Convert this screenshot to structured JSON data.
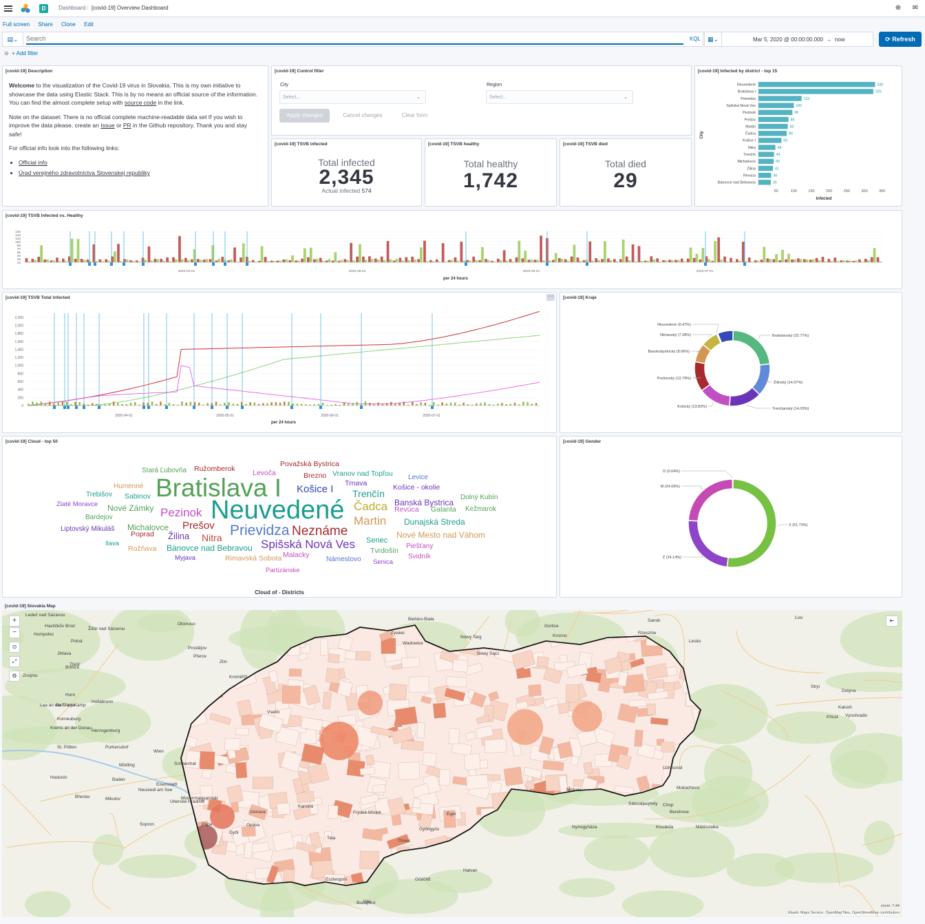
{
  "header": {
    "breadcrumb_root": "Dashboard",
    "breadcrumb_current": "[covid-19] Overview Dashboard",
    "space_letter": "D"
  },
  "links": [
    "Full screen",
    "Share",
    "Clone",
    "Edit"
  ],
  "query": {
    "placeholder": "Search",
    "language": "KQL",
    "date_from": "Mar 5, 2020 @ 00:00:00.000",
    "arrow": "→",
    "date_to": "now",
    "refresh_label": "Refresh",
    "add_filter": "+ Add filter"
  },
  "panels": {
    "description": {
      "title": "[covid-19] Description",
      "p1_bold": "Welcome",
      "p1_rest": " to the visualization of the Covid-19 virus in Slovakia. This is my own initiative to showcase the data using Elastic Stack. This is by no means an official source of the information. You can find the almost complete setup with ",
      "p1_link": "source code",
      "p1_end": " in the link.",
      "p2_a": "Note on the dataset: There is no official complete machine-readable data set If you wish to improve the data please, create an ",
      "p2_issue": "Issue",
      "p2_or": " or ",
      "p2_pr": "PR",
      "p2_end": " in the Github repository. Thank you and stay safe!",
      "p3": "For official info look into the following links:",
      "link1": "Official info",
      "link2": "Úrad verejného zdravotníctva Slovenskej republiky"
    },
    "control": {
      "title": "[covid-19] Control filter",
      "city_label": "City",
      "region_label": "Region",
      "select_placeholder": "Select...",
      "apply": "Apply changes",
      "cancel": "Cancel changes",
      "clear": "Clear form"
    },
    "infected": {
      "title": "[covid-19] TSVB infected",
      "label": "Total infected",
      "value": "2,345",
      "sub_label": "Actual infected",
      "sub_value": "574"
    },
    "healthy": {
      "title": "[covid-19] TSVB healthy",
      "label": "Total healthy",
      "value": "1,742"
    },
    "died": {
      "title": "[covid-19] TSVB died",
      "label": "Total died",
      "value": "29"
    },
    "district": {
      "title": "[covid-19] Infected by district - top 15",
      "ylabel": "City",
      "xlabel": "Infected"
    },
    "inf_vs_healthy": {
      "title": "[covid-19] TSVB Infected vs. Healthy",
      "xlabel": "per 24 hours"
    },
    "total_infected": {
      "title": "[covid-19] TSVB Total infected",
      "xlabel": "per 24 hours"
    },
    "kraje": {
      "title": "[covid-19] Kraje"
    },
    "cloud": {
      "title": "[covid-19] Cloud - top 50",
      "caption": "Cloud of - Districts"
    },
    "gender": {
      "title": "[covid-19] Gender"
    },
    "map": {
      "title": "[covid-19] Slovakia Map",
      "attribution": "Elastic Maps Service, OpenMapTiles, OpenStreetMap contributors",
      "zoom": "zoom: 7.44"
    }
  },
  "chart_data": [
    {
      "type": "bar",
      "id": "district",
      "categories": [
        "Neuvedené",
        "Bratislava I",
        "Prievidza",
        "Spišská Nová Ves",
        "Pezinok",
        "Prešov",
        "Martin",
        "Čadca",
        "Košice I",
        "Nitra",
        "Trenčín",
        "Michalovce",
        "Žilina",
        "Revúca",
        "Bánovce nad Bebravou"
      ],
      "values": [
        330,
        325,
        122,
        100,
        96,
        85,
        83,
        80,
        65,
        48,
        44,
        43,
        41,
        36,
        35
      ],
      "xticks": [
        50,
        100,
        150,
        200,
        250,
        300,
        350
      ],
      "xlim": [
        0,
        370
      ],
      "xlabel": "Infected",
      "ylabel": "City",
      "color": "#54b3c2"
    },
    {
      "type": "bar",
      "id": "inf_vs_healthy",
      "yticks": [
        10,
        25,
        40,
        55,
        70,
        85,
        100,
        110,
        120,
        130
      ],
      "xticks": [
        "2020-04-01",
        "2020-05-01",
        "2020-06-01",
        "2020-07-01"
      ],
      "colors": {
        "infected": "#c45a5a",
        "healthy": "#a6d36a",
        "annotation": "#54b3e8"
      }
    },
    {
      "type": "line",
      "id": "total_infected",
      "yticks": [
        0,
        200,
        400,
        600,
        800,
        1000,
        1200,
        1400,
        1600,
        1800,
        2000,
        2200
      ],
      "ylim": [
        0,
        2300
      ],
      "xticks": [
        "2020-04-01",
        "2020-05-01",
        "2020-06-01",
        "2020-07-01"
      ],
      "series": [
        {
          "color": "#d32f2f"
        },
        {
          "color": "#3fbb1d"
        },
        {
          "color": "#e44ce4"
        }
      ]
    },
    {
      "type": "pie",
      "id": "kraje",
      "slices": [
        {
          "label": "Bratislavský (22.77%)",
          "value": 22.77,
          "color": "#54b87f"
        },
        {
          "label": "Žilinský (14.07%)",
          "value": 14.07,
          "color": "#6089d9"
        },
        {
          "label": "Trenčianský (14.03%)",
          "value": 14.03,
          "color": "#6a34b9"
        },
        {
          "label": "Košický (13.82%)",
          "value": 13.82,
          "color": "#c24ec3"
        },
        {
          "label": "Prešovský (12.79%)",
          "value": 12.79,
          "color": "#a8292e"
        },
        {
          "label": "Banskobystrický (8.06%)",
          "value": 8.06,
          "color": "#d39754"
        },
        {
          "label": "Nitrianský (7.38%)",
          "value": 7.38,
          "color": "#c6b442"
        },
        {
          "label": "Neuvedené (0.47%)",
          "value": 0.47,
          "color": "#e6e6e6"
        },
        {
          "label": "",
          "value": 6.61,
          "color": "#3448b8"
        }
      ]
    },
    {
      "type": "pie",
      "id": "gender",
      "slices": [
        {
          "label": "X (51.73%)",
          "value": 51.73,
          "color": "#76c043"
        },
        {
          "label": "Ž (24.14%)",
          "value": 24.14,
          "color": "#8e44c8"
        },
        {
          "label": "M (24.09%)",
          "value": 24.09,
          "color": "#c54bb4"
        },
        {
          "label": "D (0.04%)",
          "value": 0.04,
          "color": "#333333"
        }
      ]
    }
  ],
  "cloud_words": [
    {
      "t": "Neuvedené",
      "c": "#1a9e8f"
    },
    {
      "t": "Bratislava I",
      "c": "#52a257"
    },
    {
      "t": "Prievidza",
      "c": "#5577d0"
    },
    {
      "t": "Neznáme",
      "c": "#a8292e"
    },
    {
      "t": "Spišská Nová Ves",
      "c": "#6a34b9"
    },
    {
      "t": "Martin",
      "c": "#d39754"
    },
    {
      "t": "Čadca",
      "c": "#c4a82a"
    },
    {
      "t": "Pezinok",
      "c": "#c24ec3"
    },
    {
      "t": "Košice I",
      "c": "#3448b8"
    },
    {
      "t": "Prešov",
      "c": "#a8292e"
    },
    {
      "t": "Trenčín",
      "c": "#1a9e8f"
    },
    {
      "t": "Žilina",
      "c": "#6a34b9"
    },
    {
      "t": "Nitra",
      "c": "#c44a3a"
    },
    {
      "t": "Michalovce",
      "c": "#52a257"
    },
    {
      "t": "Nové Zámky",
      "c": "#52a257"
    },
    {
      "t": "Banská Bystrica",
      "c": "#6a34b9"
    },
    {
      "t": "Dunajská Streda",
      "c": "#1a9e8f"
    },
    {
      "t": "Bánovce nad Bebravou",
      "c": "#1a9e8f"
    },
    {
      "t": "Nové Mesto nad Váhom",
      "c": "#d39754"
    },
    {
      "t": "Ružomberok",
      "c": "#a8292e"
    },
    {
      "t": "Považská Bystrica",
      "c": "#a8292e"
    },
    {
      "t": "Vranov nad Topľou",
      "c": "#1a9e8f"
    },
    {
      "t": "Stará Ľubovňa",
      "c": "#52a257"
    },
    {
      "t": "Levoča",
      "c": "#c24ec3"
    },
    {
      "t": "Brezno",
      "c": "#a8292e"
    },
    {
      "t": "Trnava",
      "c": "#6a34b9"
    },
    {
      "t": "Levice",
      "c": "#5577d0"
    },
    {
      "t": "Humenné",
      "c": "#d39754"
    },
    {
      "t": "Košice - okolie",
      "c": "#6a34b9"
    },
    {
      "t": "Trebišov",
      "c": "#1a9e8f"
    },
    {
      "t": "Sabinov",
      "c": "#1a9e8f"
    },
    {
      "t": "Dolný Kubín",
      "c": "#52a257"
    },
    {
      "t": "Zlaté Moravce",
      "c": "#8e44c8"
    },
    {
      "t": "Revúca",
      "c": "#c24ec3"
    },
    {
      "t": "Galanta",
      "c": "#52a257"
    },
    {
      "t": "Kežmarok",
      "c": "#52a257"
    },
    {
      "t": "Bardejov",
      "c": "#52a257"
    },
    {
      "t": "Liptovský Mikuláš",
      "c": "#6a34b9"
    },
    {
      "t": "Poprad",
      "c": "#a8292e"
    },
    {
      "t": "Senec",
      "c": "#1a9e8f"
    },
    {
      "t": "Ilava",
      "c": "#1a9e8f"
    },
    {
      "t": "Rožňava",
      "c": "#d39754"
    },
    {
      "t": "Piešťany",
      "c": "#c24ec3"
    },
    {
      "t": "Tvrdošín",
      "c": "#52a257"
    },
    {
      "t": "Svidník",
      "c": "#c24ec3"
    },
    {
      "t": "Malacky",
      "c": "#c24ec3"
    },
    {
      "t": "Myjava",
      "c": "#6a34b9"
    },
    {
      "t": "Rimavská Sobota",
      "c": "#d39754"
    },
    {
      "t": "Námestovo",
      "c": "#5577d0"
    },
    {
      "t": "Senica",
      "c": "#8e44c8"
    },
    {
      "t": "Partizánske",
      "c": "#c24ec3"
    }
  ],
  "map_labels": [
    "Ledeč nad Sázavou",
    "Havlíčkův Brod",
    "Žďár nad Sázavou",
    "Humpolec",
    "Polná",
    "Jihlava",
    "Třešť",
    "Brtnice",
    "Znojmo",
    "Laa an der Thaya",
    "Hollabrunn",
    "Horn",
    "Gars am Kamp",
    "Korneuburg",
    "Krems an der Donau",
    "Herzogenburg",
    "St. Pölten",
    "Purkersdorf",
    "Wien",
    "Schwechat",
    "Mödling",
    "Baden",
    "Eisenstadt",
    "Neusiedl am See",
    "Sopron",
    "Mosonmagyaróvár",
    "Győr",
    "Pápa",
    "Tata",
    "Esztergom",
    "Budapest",
    "Vác",
    "Gödöllő",
    "Hatvan",
    "Gyöngyös",
    "Eger",
    "Miskolc",
    "Sátoraljaújhely",
    "Nyíregyháza",
    "Kisvárda",
    "Mátészalka",
    "Olomouc",
    "Prostějov",
    "Přerov",
    "Zlín",
    "Kroměříž",
    "Vsetín",
    "Hodonín",
    "Břeclav",
    "Mikulov",
    "Uherské Hradiště",
    "Ostrava",
    "Opava",
    "Karviná",
    "Frýdek-Místek",
    "Třinec",
    "Bielsko-Biała",
    "Żywiec",
    "Wadowice",
    "Nowy Targ",
    "Nowy Sącz",
    "Gorlice",
    "Krosno",
    "Sanok",
    "Rzeszów",
    "Lesko",
    "Uzhhorod",
    "Mukachevo",
    "Berehove",
    "Chop",
    "Ľviv",
    "Stryi",
    "Dolyna",
    "Kalush",
    "Khust",
    "Vynohradiv"
  ]
}
